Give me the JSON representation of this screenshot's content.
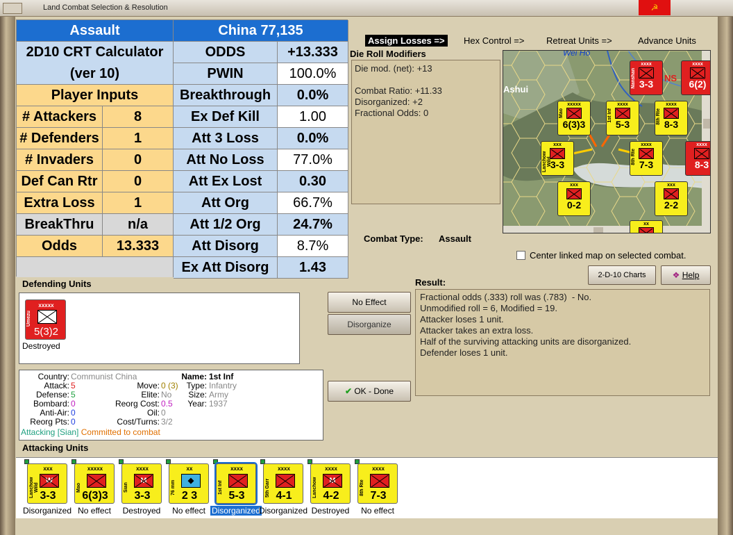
{
  "window": {
    "title": "Land Combat Selection & Resolution",
    "close_glyph": "☭"
  },
  "calc": {
    "header_left": "Assault",
    "header_right": "China 77,135",
    "title1": "2D10 CRT Calculator",
    "title2": "(ver 10)",
    "player_inputs": "Player Inputs",
    "inputs": [
      {
        "label": "# Attackers",
        "value": "8"
      },
      {
        "label": "# Defenders",
        "value": "1"
      },
      {
        "label": "# Invaders",
        "value": "0"
      },
      {
        "label": "Def Can Rtr",
        "value": "0"
      },
      {
        "label": "Extra Loss",
        "value": "1"
      },
      {
        "label": "BreakThru",
        "value": "n/a"
      },
      {
        "label": "Odds",
        "value": "13.333"
      }
    ],
    "results": [
      {
        "label": "ODDS",
        "value": "+13.333"
      },
      {
        "label": "PWIN",
        "value": "100.0%"
      },
      {
        "label": "Breakthrough",
        "value": "0.0%"
      },
      {
        "label": "Ex Def Kill",
        "value": "1.00"
      },
      {
        "label": "Att 3 Loss",
        "value": "0.0%"
      },
      {
        "label": "Att No Loss",
        "value": "77.0%"
      },
      {
        "label": "Att Ex Lost",
        "value": "0.30"
      },
      {
        "label": "Att Org",
        "value": "66.7%"
      },
      {
        "label": "Att 1/2 Org",
        "value": "24.7%"
      },
      {
        "label": "Att Disorg",
        "value": "8.7%"
      },
      {
        "label": "Ex Att Disorg",
        "value": "1.43"
      }
    ]
  },
  "tabs": {
    "assign": "Assign Losses =>",
    "hex": "Hex Control =>",
    "retreat": "Retreat Units =>",
    "advance": "Advance Units"
  },
  "die_roll": {
    "title": "Die Roll Modifiers",
    "text": "Die mod. (net): +13\n\nCombat Ratio: +11.33\nDisorganized: +2\nFractional Odds: 0"
  },
  "combat_type": {
    "label": "Combat Type:",
    "value": "Assault"
  },
  "center_map": "Center linked map on selected combat.",
  "buttons": {
    "charts": "2-D-10 Charts",
    "help": "Help",
    "no_effect": "No Effect",
    "disorganize": "Disorganize",
    "ok_done": "OK - Done"
  },
  "result": {
    "title": "Result:",
    "text": "Fractional odds (.333) roll was (.783)  - No.\nUnmodified roll = 6, Modified = 19.\nAttacker loses 1 unit.\nAttacker takes an extra loss.\nHalf of the surviving attacking units are disorganized.\nDefender loses 1 unit."
  },
  "defending": {
    "title": "Defending Units",
    "unit": {
      "size": "xxxxx",
      "name": "Umezu",
      "value": "5(3)2",
      "status": "Destroyed"
    }
  },
  "unit_info": {
    "country_label": "Country:",
    "country": "Communist China",
    "attack_label": "Attack:",
    "attack": "5",
    "defense_label": "Defense:",
    "defense": "5",
    "bombard_label": "Bombard:",
    "bombard": "0",
    "antiair_label": "Anti-Air:",
    "antiair": "0",
    "reorg_label": "Reorg Pts:",
    "reorg": "0",
    "move_label": "Move:",
    "move": "0 (3)",
    "elite_label": "Elite:",
    "elite": "No",
    "reorgcost_label": "Reorg Cost:",
    "reorgcost": "0.5",
    "oil_label": "Oil:",
    "oil": "0",
    "cost_label": "Cost/Turns:",
    "cost": "3/2",
    "name_label": "Name:",
    "name": "1st Inf",
    "type_label": "Type:",
    "type": "Infantry",
    "size_label": "Size:",
    "size": "Army",
    "year_label": "Year:",
    "year": "1937",
    "attacking": "Attacking [Sian]",
    "committed": "Committed to combat"
  },
  "attacking": {
    "title": "Attacking Units",
    "units": [
      {
        "size": "xxx",
        "name": "Lanchow Wild",
        "sym": "W",
        "value": "3-3",
        "status": "Disorganized"
      },
      {
        "size": "xxxxx",
        "name": "Mao",
        "sym": "",
        "value": "6(3)3",
        "status": "No effect"
      },
      {
        "size": "xxxx",
        "name": "Sian",
        "sym": "M",
        "value": "3-3",
        "status": "Destroyed"
      },
      {
        "size": "xx",
        "name": "76 mm",
        "sym": "◆",
        "value": "2 3",
        "status": "No effect"
      },
      {
        "size": "xxxx",
        "name": "1st Inf",
        "sym": "",
        "value": "5-3",
        "status": "Disorganized"
      },
      {
        "size": "xxxx",
        "name": "5th Garr",
        "sym": "",
        "value": "4-1",
        "status": "Disorganized"
      },
      {
        "size": "xxxx",
        "name": "Lanchow",
        "sym": "M",
        "value": "4-2",
        "status": "Destroyed"
      },
      {
        "size": "xxxx",
        "name": "8th Rte",
        "sym": "",
        "value": "7-3",
        "status": "No effect"
      }
    ]
  },
  "map": {
    "labels": [
      "Wei Ho",
      "Ashui",
      "NS"
    ],
    "counters": [
      {
        "size": "xxxx",
        "name": "Nanshan",
        "value": "3-3",
        "color": "red"
      },
      {
        "size": "xxxx",
        "name": "",
        "value": "6(2)",
        "color": "red"
      },
      {
        "size": "xxxxx",
        "name": "Mao",
        "value": "6(3)3",
        "color": "yel"
      },
      {
        "size": "xxxx",
        "name": "1st Inf",
        "value": "5-3",
        "color": "yel"
      },
      {
        "size": "xxxx",
        "name": "8th Rte",
        "value": "8-3",
        "color": "yel"
      },
      {
        "size": "xxx",
        "name": "Lanchow Wild",
        "value": "3-3",
        "color": "yel"
      },
      {
        "size": "xxxx",
        "name": "8th Rte",
        "value": "7-3",
        "color": "yel"
      },
      {
        "size": "xxxx",
        "name": "",
        "value": "8-3",
        "color": "red"
      },
      {
        "size": "xxx",
        "name": "",
        "value": "0-2",
        "color": "yel"
      },
      {
        "size": "xxx",
        "name": "",
        "value": "2-2",
        "color": "yel"
      },
      {
        "size": "xx",
        "name": "",
        "value": "",
        "color": "yel"
      }
    ]
  }
}
